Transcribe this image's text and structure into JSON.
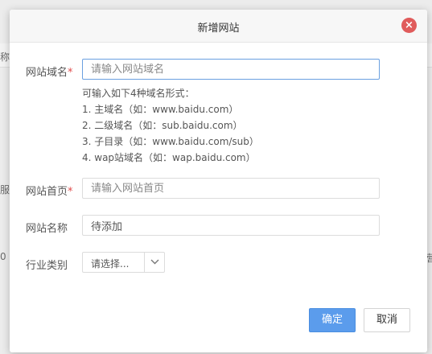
{
  "background": {
    "text_left_top": "称",
    "text_left_mid": "服",
    "text_left_low": "0",
    "text_right_low": "营"
  },
  "dialog": {
    "title": "新增网站",
    "close_icon": "close-icon",
    "close_color": "#e05b5b",
    "fields": {
      "domain": {
        "label": "网站域名",
        "required_mark": "*",
        "placeholder": "请输入网站域名",
        "value": ""
      },
      "hints": [
        "可输入如下4种域名形式：",
        "1. 主域名（如：www.baidu.com）",
        "2. 二级域名（如：sub.baidu.com）",
        "3. 子目录（如：www.baidu.com/sub）",
        "4. wap站域名（如：wap.baidu.com）"
      ],
      "homepage": {
        "label": "网站首页",
        "required_mark": "*",
        "placeholder": "请输入网站首页",
        "value": ""
      },
      "site_name": {
        "label": "网站名称",
        "value": "待添加"
      },
      "industry": {
        "label": "行业类别",
        "selected": "请选择..."
      }
    },
    "buttons": {
      "confirm": "确定",
      "cancel": "取消"
    },
    "colors": {
      "primary": "#5b9cec",
      "required": "#e04b4b"
    }
  }
}
